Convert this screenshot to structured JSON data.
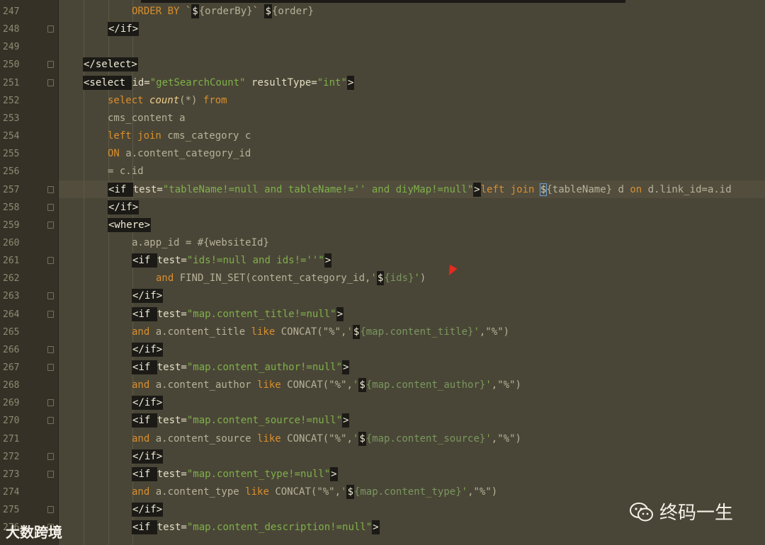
{
  "lines": [
    {
      "num": "247",
      "indent": 3,
      "segs": [
        [
          "kw",
          "ORDER BY "
        ],
        [
          "bl",
          "`"
        ],
        [
          "tg",
          "$"
        ],
        [
          "bl",
          "{orderBy}` "
        ],
        [
          "tg",
          "$"
        ],
        [
          "bl",
          "{order}"
        ]
      ]
    },
    {
      "num": "248",
      "indent": 2,
      "fold": true,
      "segs": [
        [
          "tg",
          "</if>"
        ]
      ]
    },
    {
      "num": "249",
      "indent": 0,
      "segs": []
    },
    {
      "num": "250",
      "indent": 1,
      "fold": true,
      "segs": [
        [
          "tg",
          "</select>"
        ]
      ]
    },
    {
      "num": "251",
      "indent": 1,
      "fold": true,
      "segs": [
        [
          "tg",
          "<select "
        ],
        [
          "at",
          "id="
        ],
        [
          "st",
          "\"getSearchCount\""
        ],
        [
          "at",
          " resultType="
        ],
        [
          "st",
          "\"int\""
        ],
        [
          "tg",
          ">"
        ]
      ]
    },
    {
      "num": "252",
      "indent": 2,
      "segs": [
        [
          "kw",
          "select "
        ],
        [
          "fn",
          "count"
        ],
        [
          "bl",
          "(*) "
        ],
        [
          "kw",
          "from"
        ]
      ]
    },
    {
      "num": "253",
      "indent": 2,
      "segs": [
        [
          "bl",
          "cms_content a"
        ]
      ]
    },
    {
      "num": "254",
      "indent": 2,
      "segs": [
        [
          "kw",
          "left join "
        ],
        [
          "bl",
          "cms_category c"
        ]
      ]
    },
    {
      "num": "255",
      "indent": 2,
      "segs": [
        [
          "kw",
          "ON "
        ],
        [
          "bl",
          "a.content_category_id"
        ]
      ]
    },
    {
      "num": "256",
      "indent": 2,
      "segs": [
        [
          "bl",
          "= c.id"
        ]
      ]
    },
    {
      "num": "257",
      "indent": 2,
      "fold": true,
      "segs": [
        [
          "tg",
          "<if "
        ],
        [
          "at",
          "test="
        ],
        [
          "st",
          "\"tableName!=null and tableName!='' and diyMap!=null\""
        ],
        [
          "tg",
          ">"
        ],
        [
          "kw",
          "left join "
        ],
        [
          "hl",
          "$"
        ],
        [
          "bl",
          "{tableName} d "
        ],
        [
          "kw",
          "on "
        ],
        [
          "bl",
          "d.link_id=a.id"
        ]
      ]
    },
    {
      "num": "258",
      "indent": 2,
      "fold": true,
      "segs": [
        [
          "tg",
          "</if>"
        ]
      ]
    },
    {
      "num": "259",
      "indent": 2,
      "fold": true,
      "segs": [
        [
          "tg",
          "<where>"
        ]
      ]
    },
    {
      "num": "260",
      "indent": 3,
      "segs": [
        [
          "bl",
          "a.app_id = #{websiteId}"
        ]
      ]
    },
    {
      "num": "261",
      "indent": 3,
      "fold": true,
      "segs": [
        [
          "tg",
          "<if "
        ],
        [
          "at",
          "test="
        ],
        [
          "st",
          "\"ids!=null and ids!=''\""
        ],
        [
          "tg",
          ">"
        ]
      ]
    },
    {
      "num": "262",
      "indent": 4,
      "segs": [
        [
          "kw",
          "and "
        ],
        [
          "bl",
          "FIND_IN_SET(content_category_id,"
        ],
        [
          "st",
          "'"
        ],
        [
          "tg",
          "$"
        ],
        [
          "dm",
          "{ids}"
        ],
        [
          "st",
          "'"
        ],
        [
          "bl",
          ")"
        ]
      ]
    },
    {
      "num": "263",
      "indent": 3,
      "fold": true,
      "segs": [
        [
          "tg",
          "</if>"
        ]
      ]
    },
    {
      "num": "264",
      "indent": 3,
      "fold": true,
      "segs": [
        [
          "tg",
          "<if "
        ],
        [
          "at",
          "test="
        ],
        [
          "st",
          "\"map.content_title!=null\""
        ],
        [
          "tg",
          ">"
        ]
      ]
    },
    {
      "num": "265",
      "indent": 3,
      "segs": [
        [
          "kw",
          "and "
        ],
        [
          "bl",
          "a.content_title "
        ],
        [
          "kw",
          "like "
        ],
        [
          "bl",
          "CONCAT(\"%\","
        ],
        [
          "st",
          "'"
        ],
        [
          "tg",
          "$"
        ],
        [
          "dm",
          "{map.content_title}"
        ],
        [
          "st",
          "'"
        ],
        [
          "bl",
          ",\"%\")"
        ]
      ]
    },
    {
      "num": "266",
      "indent": 3,
      "fold": true,
      "segs": [
        [
          "tg",
          "</if>"
        ]
      ]
    },
    {
      "num": "267",
      "indent": 3,
      "fold": true,
      "segs": [
        [
          "tg",
          "<if "
        ],
        [
          "at",
          "test="
        ],
        [
          "st",
          "\"map.content_author!=null\""
        ],
        [
          "tg",
          ">"
        ]
      ]
    },
    {
      "num": "268",
      "indent": 3,
      "segs": [
        [
          "kw",
          "and "
        ],
        [
          "bl",
          "a.content_author "
        ],
        [
          "kw",
          "like "
        ],
        [
          "bl",
          "CONCAT(\"%\","
        ],
        [
          "st",
          "'"
        ],
        [
          "tg",
          "$"
        ],
        [
          "dm",
          "{map.content_author}"
        ],
        [
          "st",
          "'"
        ],
        [
          "bl",
          ",\"%\")"
        ]
      ]
    },
    {
      "num": "269",
      "indent": 3,
      "fold": true,
      "segs": [
        [
          "tg",
          "</if>"
        ]
      ]
    },
    {
      "num": "270",
      "indent": 3,
      "fold": true,
      "segs": [
        [
          "tg",
          "<if "
        ],
        [
          "at",
          "test="
        ],
        [
          "st",
          "\"map.content_source!=null\""
        ],
        [
          "tg",
          ">"
        ]
      ]
    },
    {
      "num": "271",
      "indent": 3,
      "segs": [
        [
          "kw",
          "and "
        ],
        [
          "bl",
          "a.content_source "
        ],
        [
          "kw",
          "like "
        ],
        [
          "bl",
          "CONCAT(\"%\","
        ],
        [
          "st",
          "'"
        ],
        [
          "tg",
          "$"
        ],
        [
          "dm",
          "{map.content_source}"
        ],
        [
          "st",
          "'"
        ],
        [
          "bl",
          ",\"%\")"
        ]
      ]
    },
    {
      "num": "272",
      "indent": 3,
      "fold": true,
      "segs": [
        [
          "tg",
          "</if>"
        ]
      ]
    },
    {
      "num": "273",
      "indent": 3,
      "fold": true,
      "segs": [
        [
          "tg",
          "<if "
        ],
        [
          "at",
          "test="
        ],
        [
          "st",
          "\"map.content_type!=null\""
        ],
        [
          "tg",
          ">"
        ]
      ]
    },
    {
      "num": "274",
      "indent": 3,
      "segs": [
        [
          "kw",
          "and "
        ],
        [
          "bl",
          "a.content_type "
        ],
        [
          "kw",
          "like "
        ],
        [
          "bl",
          "CONCAT(\"%\","
        ],
        [
          "st",
          "'"
        ],
        [
          "tg",
          "$"
        ],
        [
          "dm",
          "{map.content_type}"
        ],
        [
          "st",
          "'"
        ],
        [
          "bl",
          ",\"%\")"
        ]
      ]
    },
    {
      "num": "275",
      "indent": 3,
      "fold": true,
      "segs": [
        [
          "tg",
          "</if>"
        ]
      ]
    },
    {
      "num": "276",
      "indent": 3,
      "fold": true,
      "segs": [
        [
          "tg",
          "<if "
        ],
        [
          "at",
          "test="
        ],
        [
          "st",
          "\"map.content_description!=null\""
        ],
        [
          "tg",
          ">"
        ]
      ]
    }
  ],
  "watermark_left": "大数跨境",
  "watermark_right": "终码一生",
  "colors": {
    "background": "#4a4637",
    "gutter": "#353126",
    "tag_bg": "#1b1a16",
    "keyword": "#d98f2e",
    "string": "#7fb04a"
  }
}
